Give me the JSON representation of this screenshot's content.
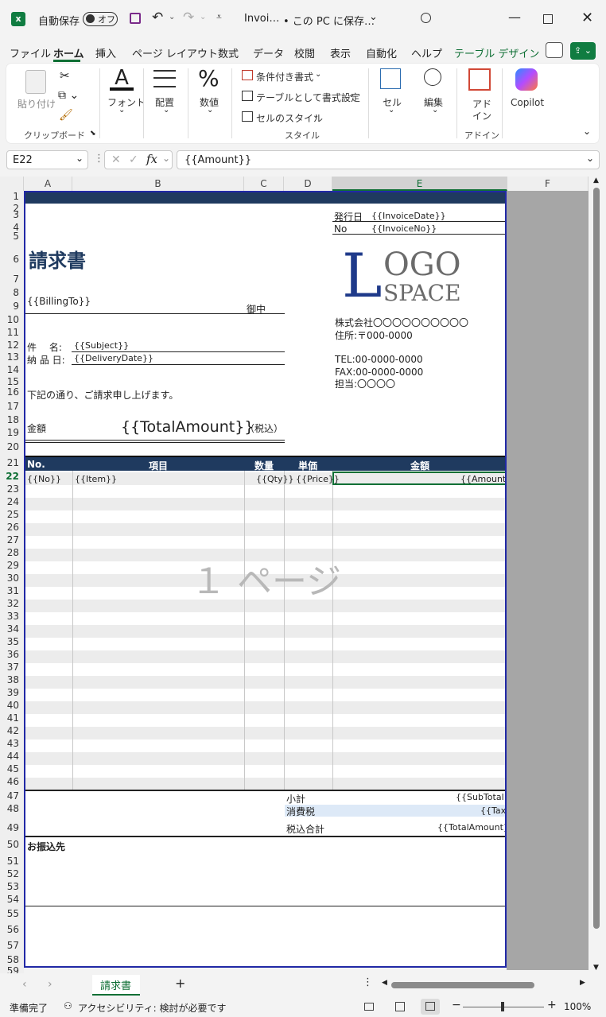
{
  "titlebar": {
    "autosave_label": "自動保存",
    "autosave_state": "オフ",
    "file_name": "Invoi…",
    "location": "• この PC に保存…"
  },
  "menu": [
    "ファイル",
    "ホーム",
    "挿入",
    "ページ レイアウト",
    "数式",
    "データ",
    "校閲",
    "表示",
    "自動化",
    "ヘルプ",
    "テーブル デザイン"
  ],
  "ribbon": {
    "paste": "貼り付け",
    "clipboard_group": "クリップボード",
    "font": "フォント",
    "alignment": "配置",
    "number": "数値",
    "conditional": "条件付き書式",
    "table_format": "テーブルとして書式設定",
    "cell_styles": "セルのスタイル",
    "style_group": "スタイル",
    "cells": "セル",
    "editing": "編集",
    "addin_line1": "アド",
    "addin_line2": "イン",
    "addin_group": "アドイン",
    "copilot": "Copilot"
  },
  "formula": {
    "name_box": "E22",
    "fx": "fx",
    "content": "{{Amount}}"
  },
  "columns": [
    "A",
    "B",
    "C",
    "D",
    "E",
    "F"
  ],
  "rows": [
    "1",
    "2",
    "3",
    "4",
    "5",
    "6",
    "7",
    "8",
    "9",
    "10",
    "11",
    "12",
    "13",
    "14",
    "15",
    "16",
    "17",
    "18",
    "19",
    "20",
    "21",
    "22",
    "23",
    "24",
    "25",
    "26",
    "27",
    "28",
    "29",
    "30",
    "31",
    "32",
    "33",
    "34",
    "35",
    "36",
    "37",
    "38",
    "39",
    "40",
    "41",
    "42",
    "43",
    "44",
    "45",
    "46",
    "47",
    "48",
    "49",
    "50",
    "51",
    "52",
    "53",
    "54",
    "55",
    "56",
    "57",
    "58",
    "59"
  ],
  "invoice": {
    "issue_date_label": "発行日",
    "issue_date": "{{InvoiceDate}}",
    "no_label": "No",
    "no": "{{InvoiceNo}}",
    "title": "請求書",
    "billing_to": "{{BillingTo}}",
    "honorific": "御中",
    "logo_l": "L",
    "logo_ogo": "OGO",
    "logo_space": "SPACE",
    "company": "株式会社〇〇〇〇〇〇〇〇〇〇",
    "address": "住所:〒000-0000",
    "tel": "TEL:00-0000-0000",
    "fax": "FAX:00-0000-0000",
    "contact": "担当:〇〇〇〇",
    "subject_label": "件　 名:",
    "subject": "{{Subject}}",
    "delivery_label": "納 品 日:",
    "delivery": "{{DeliveryDate}}",
    "message": "下記の通り、ご請求申し上げます。",
    "amount_label": "金額",
    "total_amount": "{{TotalAmount}}",
    "tax_incl": "（税込）",
    "header_no": "No.",
    "header_item": "項目",
    "header_qty": "数量",
    "header_price": "単価",
    "header_amount": "金額",
    "row_no": "{{No}}",
    "row_item": "{{Item}}",
    "row_qty": "{{Qty}}",
    "row_price": "{{Price}}",
    "row_amount": "{{Amount}}",
    "page_watermark": "１ ページ",
    "subtotal_label": "小計",
    "subtotal": "{{SubTotal}}",
    "tax_label": "消費税",
    "tax": "{{Tax}}",
    "total_label": "税込合計",
    "total": "{{TotalAmount}}",
    "bank_label": "お振込先"
  },
  "sheet_tab": "請求書",
  "status": {
    "ready": "準備完了",
    "accessibility": "アクセシビリティ: 検討が必要です",
    "zoom": "100%"
  },
  "colors": {
    "excel_green": "#0f6f35",
    "header_navy": "#1f3a5f",
    "page_border": "#2129a6",
    "logo_blue": "#1f3a8a"
  }
}
